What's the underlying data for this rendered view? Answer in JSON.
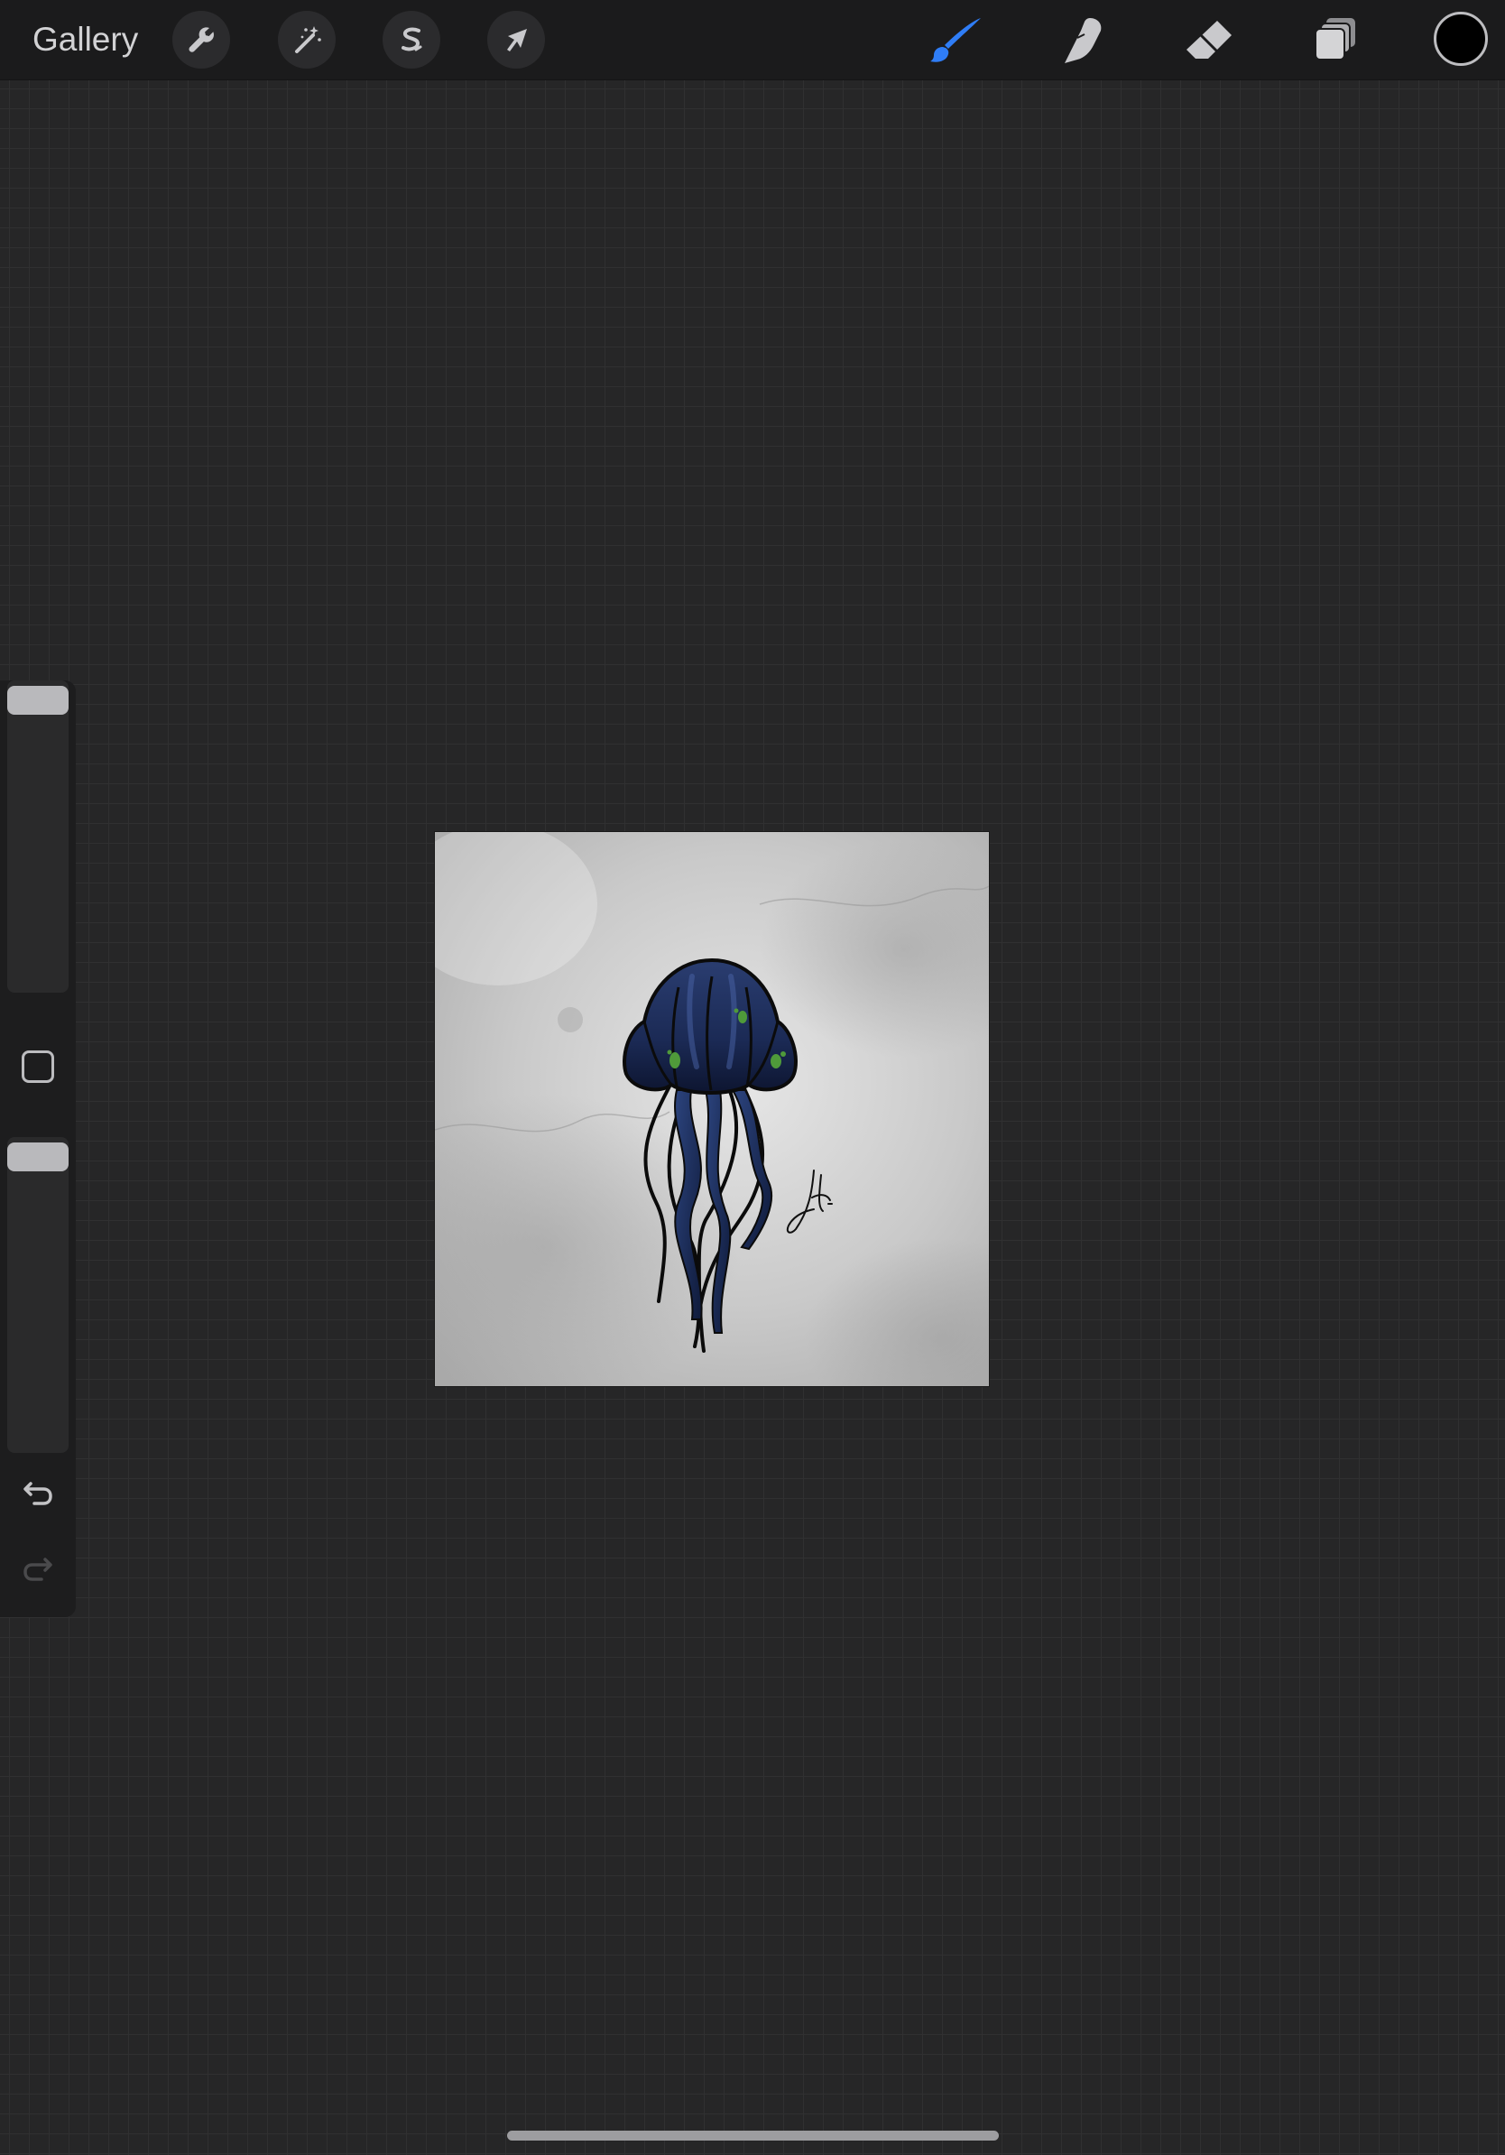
{
  "topbar": {
    "gallery_label": "Gallery",
    "left_tools": [
      {
        "name": "actions",
        "icon": "wrench-icon"
      },
      {
        "name": "adjustments",
        "icon": "magic-wand-icon"
      },
      {
        "name": "selection",
        "icon": "selection-s-icon"
      },
      {
        "name": "transform",
        "icon": "arrow-cursor-icon"
      }
    ],
    "right_tools": [
      {
        "name": "brush",
        "icon": "brush-icon",
        "active": true
      },
      {
        "name": "smudge",
        "icon": "smudge-finger-icon",
        "active": false
      },
      {
        "name": "eraser",
        "icon": "eraser-icon",
        "active": false
      },
      {
        "name": "layers",
        "icon": "layers-icon",
        "active": false
      }
    ],
    "current_color": "#000000"
  },
  "sidebar": {
    "brush_size_level": 1.0,
    "opacity_level": 1.0,
    "modify_icon": "square-modify-icon",
    "undo_icon": "undo-arrow-icon",
    "redo_icon": "redo-arrow-icon",
    "redo_enabled": false
  },
  "canvas": {
    "artwork": "jellyfish-illustration",
    "signature": "artist-signature"
  },
  "colors": {
    "accent": "#2f7df6",
    "toolbar_bg": "#1b1b1c",
    "workspace_bg": "#262627"
  }
}
